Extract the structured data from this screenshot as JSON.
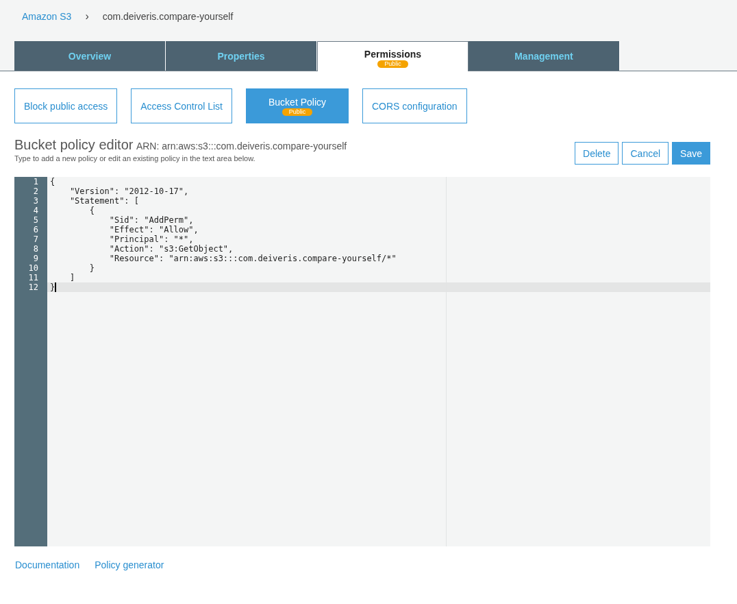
{
  "breadcrumb": [
    {
      "label": "Amazon S3",
      "kind": "link"
    },
    {
      "label": "com.deiveris.compare-yourself",
      "kind": "current"
    }
  ],
  "breadcrumb_separator": "›",
  "tabs": [
    {
      "label": "Overview",
      "selected": false
    },
    {
      "label": "Properties",
      "selected": false
    },
    {
      "label": "Permissions",
      "selected": true,
      "badge": "Public"
    },
    {
      "label": "Management",
      "selected": false
    }
  ],
  "subtabs": [
    {
      "label": "Block public access",
      "selected": false
    },
    {
      "label": "Access Control List",
      "selected": false
    },
    {
      "label": "Bucket Policy",
      "selected": true,
      "badge": "Public"
    },
    {
      "label": "CORS configuration",
      "selected": false
    }
  ],
  "editor": {
    "title": "Bucket policy editor",
    "arn": "ARN: arn:aws:s3:::com.deiveris.compare-yourself",
    "hint": "Type to add a new policy or edit an existing policy in the text area below.",
    "buttons": [
      {
        "label": "Delete",
        "kind": "secondary"
      },
      {
        "label": "Cancel",
        "kind": "secondary"
      },
      {
        "label": "Save",
        "kind": "primary"
      }
    ],
    "lines": [
      {
        "number": "1",
        "text": "{",
        "active": false
      },
      {
        "number": "2",
        "text": "    \"Version\": \"2012-10-17\",",
        "active": false
      },
      {
        "number": "3",
        "text": "    \"Statement\": [",
        "active": false
      },
      {
        "number": "4",
        "text": "        {",
        "active": false
      },
      {
        "number": "5",
        "text": "            \"Sid\": \"AddPerm\",",
        "active": false
      },
      {
        "number": "6",
        "text": "            \"Effect\": \"Allow\",",
        "active": false
      },
      {
        "number": "7",
        "text": "            \"Principal\": \"*\",",
        "active": false
      },
      {
        "number": "8",
        "text": "            \"Action\": \"s3:GetObject\",",
        "active": false
      },
      {
        "number": "9",
        "text": "            \"Resource\": \"arn:aws:s3:::com.deiveris.compare-yourself/*\"",
        "active": false
      },
      {
        "number": "10",
        "text": "        }",
        "active": false
      },
      {
        "number": "11",
        "text": "    ]",
        "active": false
      },
      {
        "number": "12",
        "text": "}",
        "active": true
      }
    ]
  },
  "footer_links": [
    "Documentation",
    "Policy generator"
  ]
}
